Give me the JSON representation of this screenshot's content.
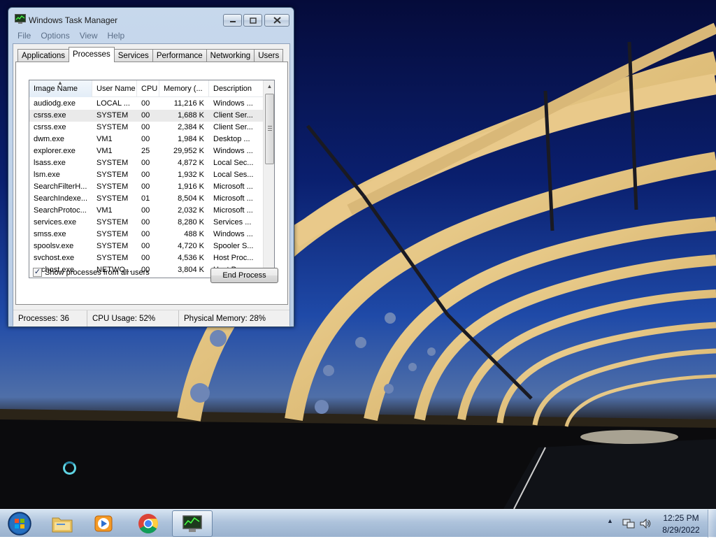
{
  "window": {
    "title": "Windows Task Manager",
    "menu": [
      "File",
      "Options",
      "View",
      "Help"
    ],
    "tabs": [
      "Applications",
      "Processes",
      "Services",
      "Performance",
      "Networking",
      "Users"
    ],
    "active_tab": "Processes"
  },
  "process_table": {
    "columns": [
      "Image Name",
      "User Name",
      "CPU",
      "Memory (...",
      "Description"
    ],
    "sorted_by": "Image Name",
    "selected_row": 1,
    "rows": [
      {
        "name": "audiodg.exe",
        "user": "LOCAL ...",
        "cpu": "00",
        "memory": "11,216 K",
        "description": "Windows ..."
      },
      {
        "name": "csrss.exe",
        "user": "SYSTEM",
        "cpu": "00",
        "memory": "1,688 K",
        "description": "Client Ser..."
      },
      {
        "name": "csrss.exe",
        "user": "SYSTEM",
        "cpu": "00",
        "memory": "2,384 K",
        "description": "Client Ser..."
      },
      {
        "name": "dwm.exe",
        "user": "VM1",
        "cpu": "00",
        "memory": "1,984 K",
        "description": "Desktop ..."
      },
      {
        "name": "explorer.exe",
        "user": "VM1",
        "cpu": "25",
        "memory": "29,952 K",
        "description": "Windows ..."
      },
      {
        "name": "lsass.exe",
        "user": "SYSTEM",
        "cpu": "00",
        "memory": "4,872 K",
        "description": "Local Sec..."
      },
      {
        "name": "lsm.exe",
        "user": "SYSTEM",
        "cpu": "00",
        "memory": "1,932 K",
        "description": "Local Ses..."
      },
      {
        "name": "SearchFilterH...",
        "user": "SYSTEM",
        "cpu": "00",
        "memory": "1,916 K",
        "description": "Microsoft ..."
      },
      {
        "name": "SearchIndexe...",
        "user": "SYSTEM",
        "cpu": "01",
        "memory": "8,504 K",
        "description": "Microsoft ..."
      },
      {
        "name": "SearchProtoc...",
        "user": "VM1",
        "cpu": "00",
        "memory": "2,032 K",
        "description": "Microsoft ..."
      },
      {
        "name": "services.exe",
        "user": "SYSTEM",
        "cpu": "00",
        "memory": "8,280 K",
        "description": "Services ..."
      },
      {
        "name": "smss.exe",
        "user": "SYSTEM",
        "cpu": "00",
        "memory": "488 K",
        "description": "Windows ..."
      },
      {
        "name": "spoolsv.exe",
        "user": "SYSTEM",
        "cpu": "00",
        "memory": "4,720 K",
        "description": "Spooler S..."
      },
      {
        "name": "svchost.exe",
        "user": "SYSTEM",
        "cpu": "00",
        "memory": "4,536 K",
        "description": "Host Proc..."
      },
      {
        "name": "svchost.exe",
        "user": "NETWO...",
        "cpu": "00",
        "memory": "3,804 K",
        "description": "Host Proc..."
      }
    ]
  },
  "controls": {
    "show_all_label": "Show processes from all users",
    "show_all_checked": true,
    "check_glyph": "✓",
    "end_process_label": "End Process"
  },
  "status": {
    "processes": "Processes: 36",
    "cpu_usage": "CPU Usage: 52%",
    "physical_memory": "Physical Memory: 28%"
  },
  "taskbar": {
    "pinned": [
      "folder-icon",
      "media-player-icon",
      "chrome-icon",
      "task-manager-icon"
    ],
    "clock_time": "12:25 PM",
    "clock_date": "8/29/2022"
  },
  "colors": {
    "selection": "#eaeaea",
    "window_frame": "#b9cde6",
    "taskbar": "#aac0da"
  }
}
